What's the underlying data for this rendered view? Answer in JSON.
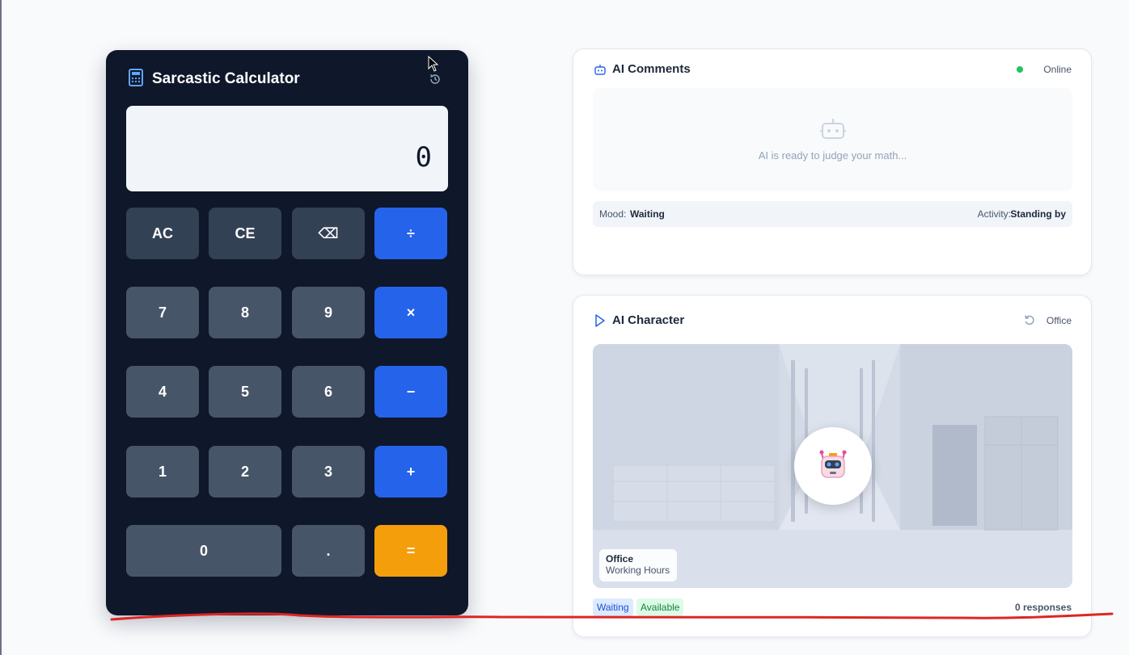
{
  "calculator": {
    "title": "Sarcastic Calculator",
    "display_value": "0",
    "keys": [
      {
        "label": "AC",
        "kind": "function"
      },
      {
        "label": "CE",
        "kind": "function"
      },
      {
        "label": "⌫",
        "kind": "function"
      },
      {
        "label": "÷",
        "kind": "operator"
      },
      {
        "label": "7",
        "kind": "number"
      },
      {
        "label": "8",
        "kind": "number"
      },
      {
        "label": "9",
        "kind": "number"
      },
      {
        "label": "×",
        "kind": "operator"
      },
      {
        "label": "4",
        "kind": "number"
      },
      {
        "label": "5",
        "kind": "number"
      },
      {
        "label": "6",
        "kind": "number"
      },
      {
        "label": "−",
        "kind": "operator"
      },
      {
        "label": "1",
        "kind": "number"
      },
      {
        "label": "2",
        "kind": "number"
      },
      {
        "label": "3",
        "kind": "number"
      },
      {
        "label": "+",
        "kind": "operator"
      },
      {
        "label": "0",
        "kind": "number"
      },
      {
        "label": ".",
        "kind": "number"
      },
      {
        "label": "=",
        "kind": "equals"
      }
    ]
  },
  "comments": {
    "title": "AI Comments",
    "status": "Online",
    "empty_text": "AI is ready to judge your math...",
    "mood_label": "Mood:",
    "mood_value": "Waiting",
    "activity_label": "Activity:",
    "activity_value": "Standing by"
  },
  "character": {
    "title": "AI Character",
    "location": "Office",
    "badge_title": "Office",
    "badge_subtitle": "Working Hours",
    "tags": [
      "Waiting",
      "Available"
    ],
    "responses": "0 responses"
  },
  "colors": {
    "calc_bg": "#0f172a",
    "operator": "#2563eb",
    "equals": "#f59e0b",
    "online": "#22c55e",
    "annotation": "#dc2626"
  },
  "icons": {
    "calc_title_icon": "calculator-icon",
    "history": "history-icon",
    "comments_title_icon": "bot-icon",
    "empty_icon": "bot-icon",
    "character_title_icon": "play-icon",
    "refresh": "refresh-icon",
    "avatar": "robot-emoji"
  }
}
